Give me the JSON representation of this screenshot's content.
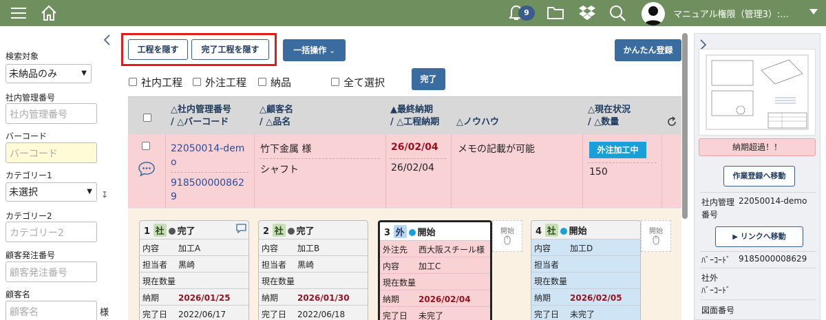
{
  "topbar": {
    "notification_count": "9",
    "user_name": "マニュアル権限（管理3）:..."
  },
  "left": {
    "search_target_label": "検索対象",
    "search_target_value": "未納品のみ",
    "mgmt_no_label": "社内管理番号",
    "mgmt_no_placeholder": "社内管理番号",
    "barcode_label": "バーコード",
    "barcode_placeholder": "バーコード",
    "category1_label": "カテゴリー1",
    "category1_value": "未選択",
    "category2_label": "カテゴリー2",
    "category2_placeholder": "カテゴリー2",
    "customer_order_label": "顧客発注番号",
    "customer_order_placeholder": "顧客発注番号",
    "customer_name_label": "顧客名",
    "customer_name_placeholder": "顧客名",
    "sama": "様"
  },
  "toolbar": {
    "hide_process": "工程を隠す",
    "hide_done_process": "完了工程を隠す",
    "bulk_action": "一括操作",
    "easy_register": "かんたん登録",
    "chk_internal": "社内工程",
    "chk_external": "外注工程",
    "chk_delivery": "納品",
    "chk_all": "全て選択",
    "done": "完了"
  },
  "table": {
    "headers": {
      "mgmt_no": "△社内管理番号",
      "barcode": "/ △バーコード",
      "customer": "△顧客名",
      "item": "/ △品名",
      "final_due": "▲最終納期",
      "process_due": "/ △工程納期",
      "knowhow": "△ノウハウ",
      "status": "△現在状況",
      "qty": "/ △数量"
    },
    "row": {
      "mgmt_no_1": "22050014-dem",
      "mgmt_no_2": "o",
      "barcode_1": "918500000862",
      "barcode_2": "9",
      "customer": "竹下金属 様",
      "item": "シャフト",
      "final_due": "26/02/04",
      "process_due": "26/02/04",
      "knowhow": "メモの記載が可能",
      "status": "外注加工中",
      "qty": "150"
    }
  },
  "cards": [
    {
      "no": "1",
      "tag": "社",
      "state": "完了",
      "k1": "内容",
      "v1": "加工A",
      "k2": "担当者",
      "v2": "黒崎",
      "k3": "現在数量",
      "v3": "",
      "k4": "納期",
      "v4": "2026/01/25",
      "k5": "完了日",
      "v5": "2022/06/17"
    },
    {
      "no": "2",
      "tag": "社",
      "state": "完了",
      "k1": "内容",
      "v1": "加工B",
      "k2": "担当者",
      "v2": "黒崎",
      "k3": "現在数量",
      "v3": "",
      "k4": "納期",
      "v4": "2026/01/30",
      "k5": "完了日",
      "v5": "2022/06/18"
    },
    {
      "no": "3",
      "tag": "外",
      "state": "開始",
      "k1": "外注先",
      "v1": "西大阪スチール様",
      "k2": "内容",
      "v2": "加工C",
      "k3": "現在数量",
      "v3": "",
      "k4": "納期",
      "v4": "2026/02/04",
      "k5": "完了日",
      "v5": "未完了"
    },
    {
      "no": "4",
      "tag": "社",
      "state": "開始",
      "k1": "内容",
      "v1": "加工D",
      "k2": "担当者",
      "v2": "",
      "k3": "現在数量",
      "v3": "",
      "k4": "納期",
      "v4": "2026/02/05",
      "k5": "完了日",
      "v5": "未完了"
    }
  ],
  "mini_start": "開始",
  "right": {
    "overdue": "納期超過！！",
    "goto_work": "作業登録へ移動",
    "mgmt_label_1": "社内管理",
    "mgmt_label_2": "番号",
    "mgmt_value": "22050014-demo",
    "goto_link": "リンクへ移動",
    "barcode_label": "ﾊﾞｰｺｰﾄﾞ",
    "barcode_value": "9185000008629",
    "ext_barcode_1": "社外",
    "ext_barcode_2": "ﾊﾞｰｺｰﾄﾞ",
    "drawing_no": "図面番号"
  }
}
